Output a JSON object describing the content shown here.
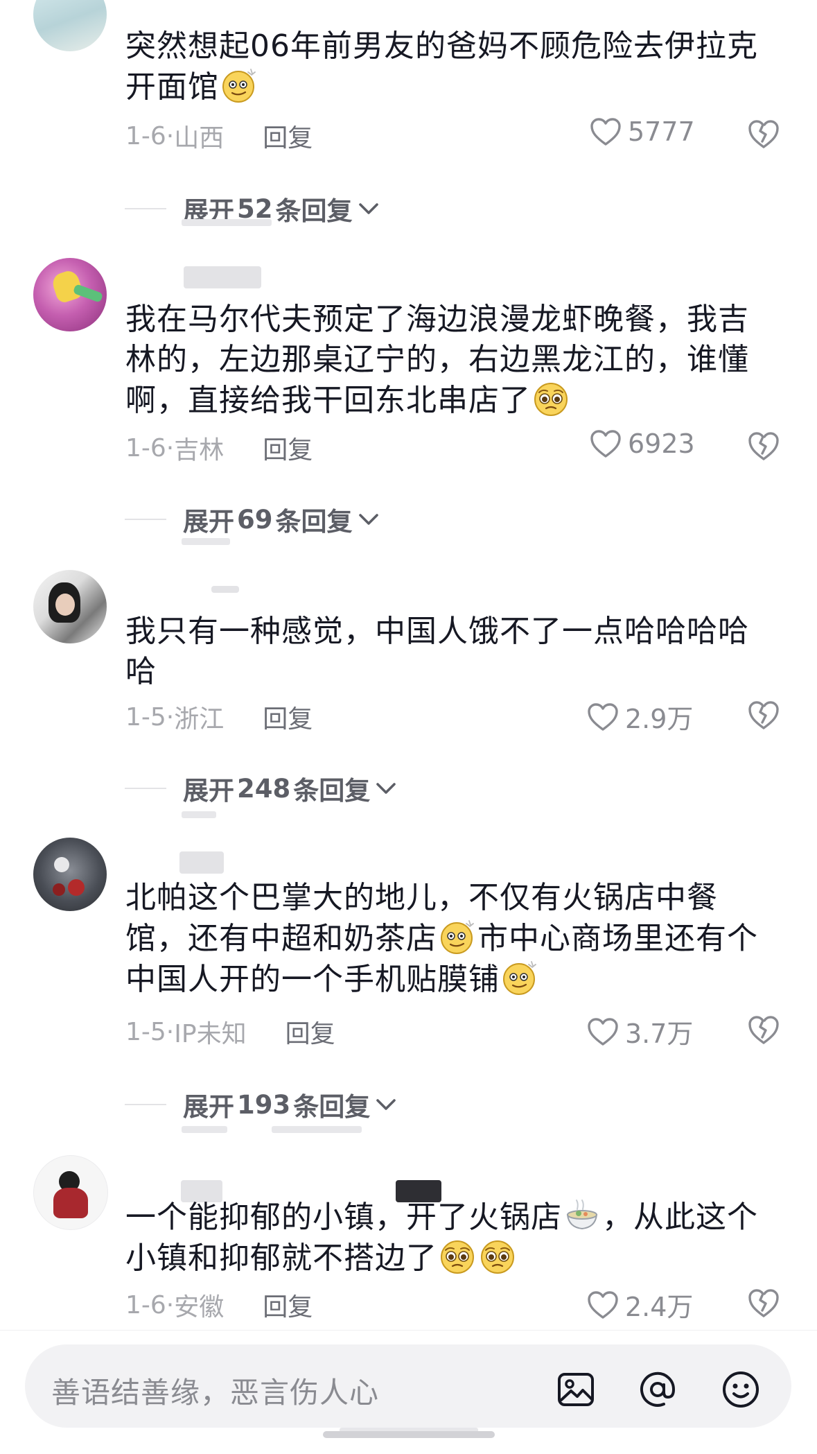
{
  "comments": [
    {
      "text": "突然想起06年前男友的爸妈不顾危险去伊拉克开面馆",
      "date": "1-6·",
      "location": "山西",
      "reply_label": "回复",
      "likes": "5777",
      "expand_prefix": "展开",
      "expand_count": "52",
      "expand_suffix": "条回复"
    },
    {
      "text": "我在马尔代夫预定了海边浪漫龙虾晚餐，我吉林的，左边那桌辽宁的，右边黑龙江的，谁懂啊，直接给我干回东北串店了",
      "date": "1-6·",
      "location": "吉林",
      "reply_label": "回复",
      "likes": "6923",
      "expand_prefix": "展开",
      "expand_count": "69",
      "expand_suffix": "条回复"
    },
    {
      "text": "我只有一种感觉，中国人饿不了一点哈哈哈哈哈",
      "date": "1-5·",
      "location": "浙江",
      "reply_label": "回复",
      "likes": "2.9万",
      "expand_prefix": "展开",
      "expand_count": "248",
      "expand_suffix": "条回复"
    },
    {
      "text_part1": "北帕这个巴掌大的地儿，不仅有火锅店中餐馆，还有中超和奶茶店",
      "text_part2": "市中心商场里还有个中国人开的一个手机贴膜铺",
      "date": "1-5·",
      "location": "IP未知",
      "reply_label": "回复",
      "likes": "3.7万",
      "expand_prefix": "展开",
      "expand_count": "193",
      "expand_suffix": "条回复"
    },
    {
      "text_part1": "一个能抑郁的小镇，开了火锅店",
      "text_part2": "，从此这个小镇和抑郁就不搭边了",
      "date": "1-6·",
      "location": "安徽",
      "reply_label": "回复",
      "likes": "2.4万"
    }
  ],
  "input": {
    "placeholder": "善语结善缘，恶言伤人心"
  },
  "icons": {
    "like": "heart-outline-icon",
    "dislike": "broken-heart-icon",
    "expand": "chevron-down-icon",
    "image": "image-icon",
    "mention": "at-icon",
    "emoji": "smiley-icon"
  }
}
